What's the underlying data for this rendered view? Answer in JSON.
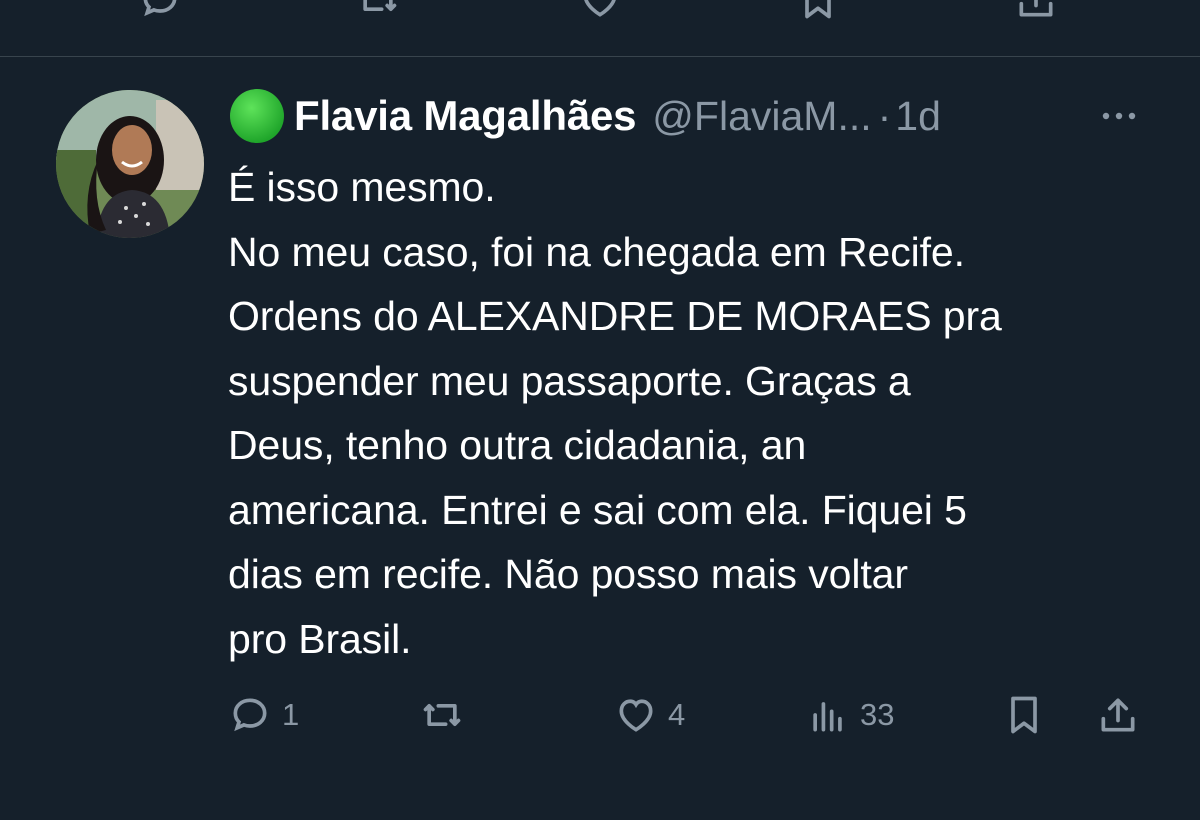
{
  "previous_tweet_actions": {
    "icons": [
      "reply-icon",
      "retweet-icon",
      "like-icon",
      "bookmark-icon",
      "share-icon"
    ]
  },
  "tweet": {
    "status_emoji": "green-circle",
    "author_name": "Flavia Magalhães",
    "handle": "@FlaviaM...",
    "separator": "·",
    "time": "1d",
    "text": "É isso mesmo.\nNo meu caso, foi na chegada em Recife.\nOrdens do ALEXANDRE DE MORAES pra\nsuspender meu passaporte. Graças a\nDeus, tenho outra cidadania, an\namericana. Entrei e sai com ela. Fiquei 5\ndias em recife. Não posso mais voltar\npro Brasil.",
    "replies": "1",
    "retweets": "",
    "likes": "4",
    "views": "33"
  },
  "colors": {
    "background": "#15202b",
    "text": "#ffffff",
    "muted": "#8b98a5",
    "divider": "#38444d",
    "status_green": "#2ecc40"
  }
}
